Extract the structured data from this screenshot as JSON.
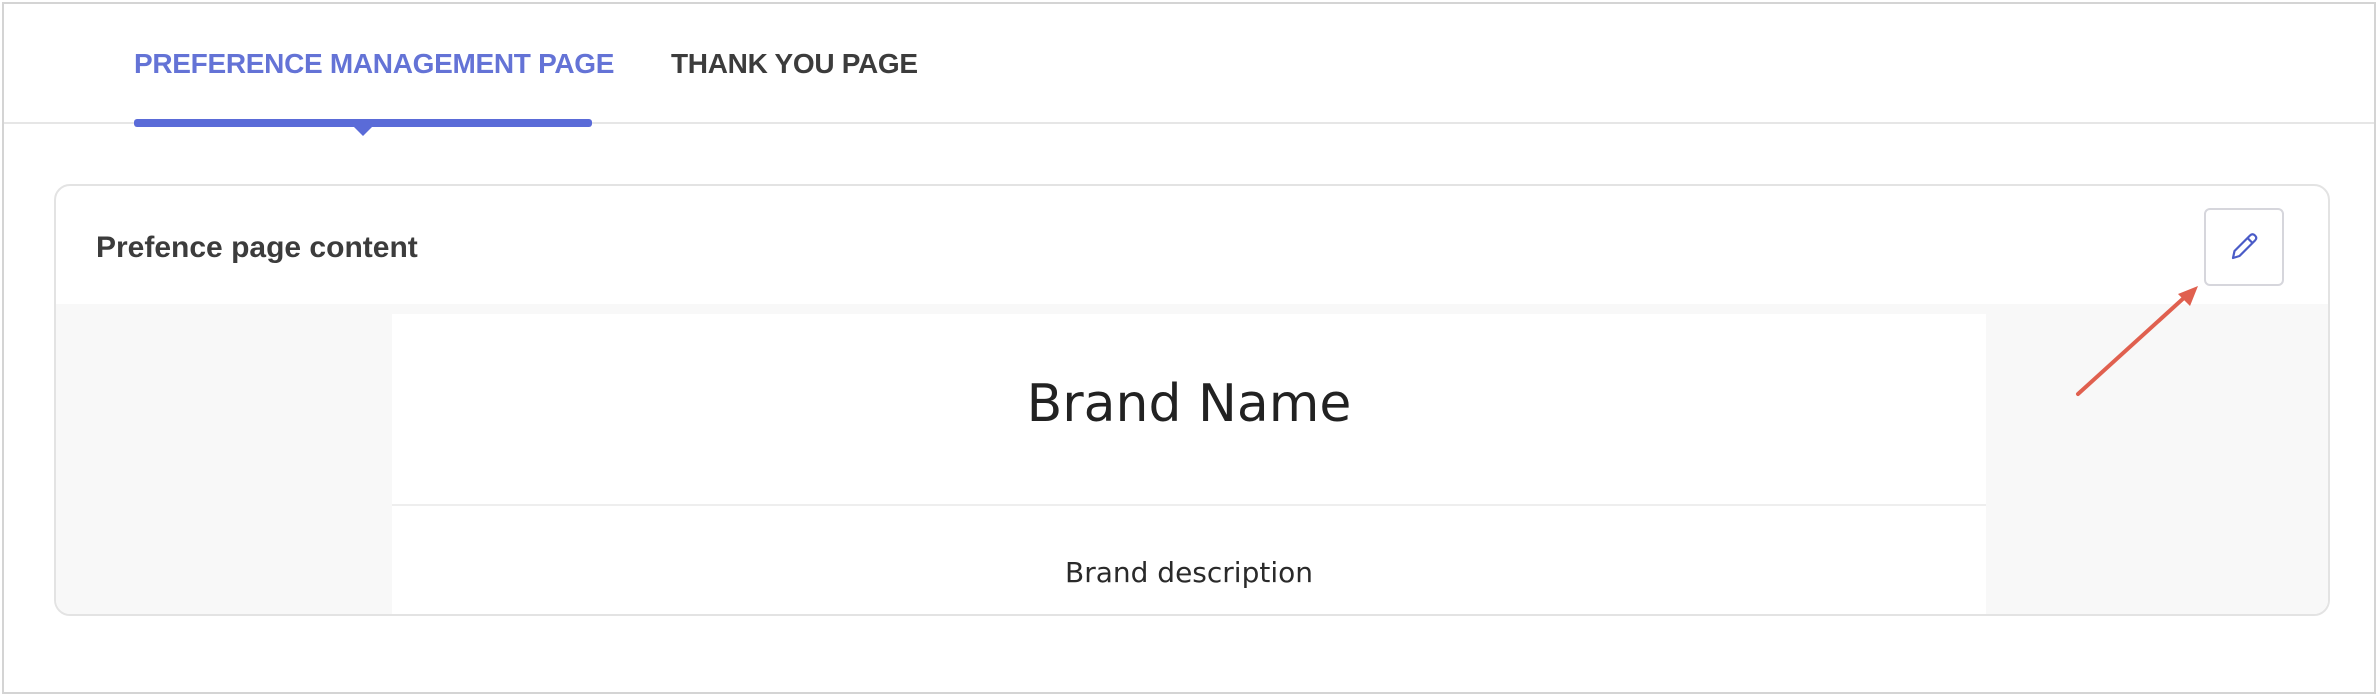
{
  "tabs": [
    {
      "label": "PREFERENCE MANAGEMENT PAGE",
      "active": true
    },
    {
      "label": "THANK YOU PAGE",
      "active": false
    }
  ],
  "card": {
    "title": "Prefence page content",
    "edit_icon": "pencil-icon"
  },
  "preview": {
    "brand_name": "Brand Name",
    "brand_description": "Brand description"
  },
  "annotation": {
    "arrow_icon": "arrow-icon",
    "arrow_color": "#e0604f"
  },
  "colors": {
    "accent": "#5a6bd8",
    "active_tab_text": "#6473d6",
    "pencil": "#4a5bc7"
  }
}
